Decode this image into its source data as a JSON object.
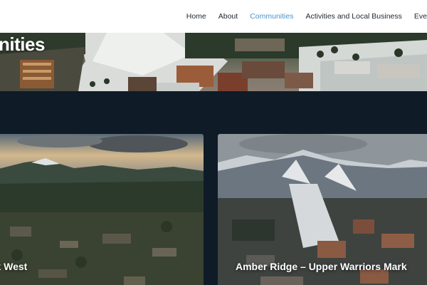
{
  "nav": {
    "items": [
      {
        "label": "Home",
        "active": false
      },
      {
        "label": "About",
        "active": false
      },
      {
        "label": "Communities",
        "active": true
      },
      {
        "label": "Activities and Local Business",
        "active": false
      },
      {
        "label": "Events",
        "active": false
      }
    ]
  },
  "hero": {
    "title": "nities"
  },
  "cards": [
    {
      "title": "rk West"
    },
    {
      "title": "Amber Ridge – Upper Warriors Mark"
    }
  ],
  "colors": {
    "nav_active": "#4a93c9",
    "nav_text": "#1f2730",
    "background": "#0f1b27"
  }
}
